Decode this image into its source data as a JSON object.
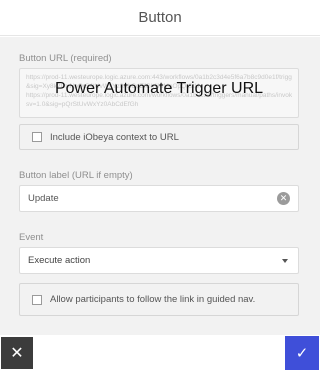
{
  "dialog": {
    "title": "Button"
  },
  "url_field": {
    "label": "Button URL (required)",
    "lines": [
      "https://prod-11.westeurope.logic.azure.com:443/workflows/0a1b2c3d4e5f6a7b8c9d0e1f/triggers/manual/paths/invoke?api-version=2016-06-01&sp=%2Ftriggers%2Fmanual%2Frun&sv=1.0",
      "&sig=Xy8k2LmNpQrS4tUvWxYz0AbCdEfGhIjKlMnOpQrStUv",
      "https://prod-11.westeurope.logic.azure.com/workflows/0a1b2c3d/triggers/manual/paths/invoke",
      "sv=1.0&sig=pQrStUvWxYz0AbCdEfGh"
    ],
    "overlay_text": "Power Automate Trigger URL"
  },
  "include_context": {
    "label": "Include iObeya context to URL",
    "checked": false
  },
  "button_label_field": {
    "label": "Button label (URL if empty)",
    "value": "Update"
  },
  "event_field": {
    "label": "Event",
    "value": "Execute action"
  },
  "guided_nav": {
    "label": "Allow participants to follow the link in guided nav.",
    "checked": false
  },
  "footer": {
    "cancel_icon": "close-icon",
    "confirm_icon": "check-icon"
  },
  "colors": {
    "primary": "#3f4fd9",
    "cancel": "#3c3c3c",
    "body_bg": "#f2f2f2"
  }
}
